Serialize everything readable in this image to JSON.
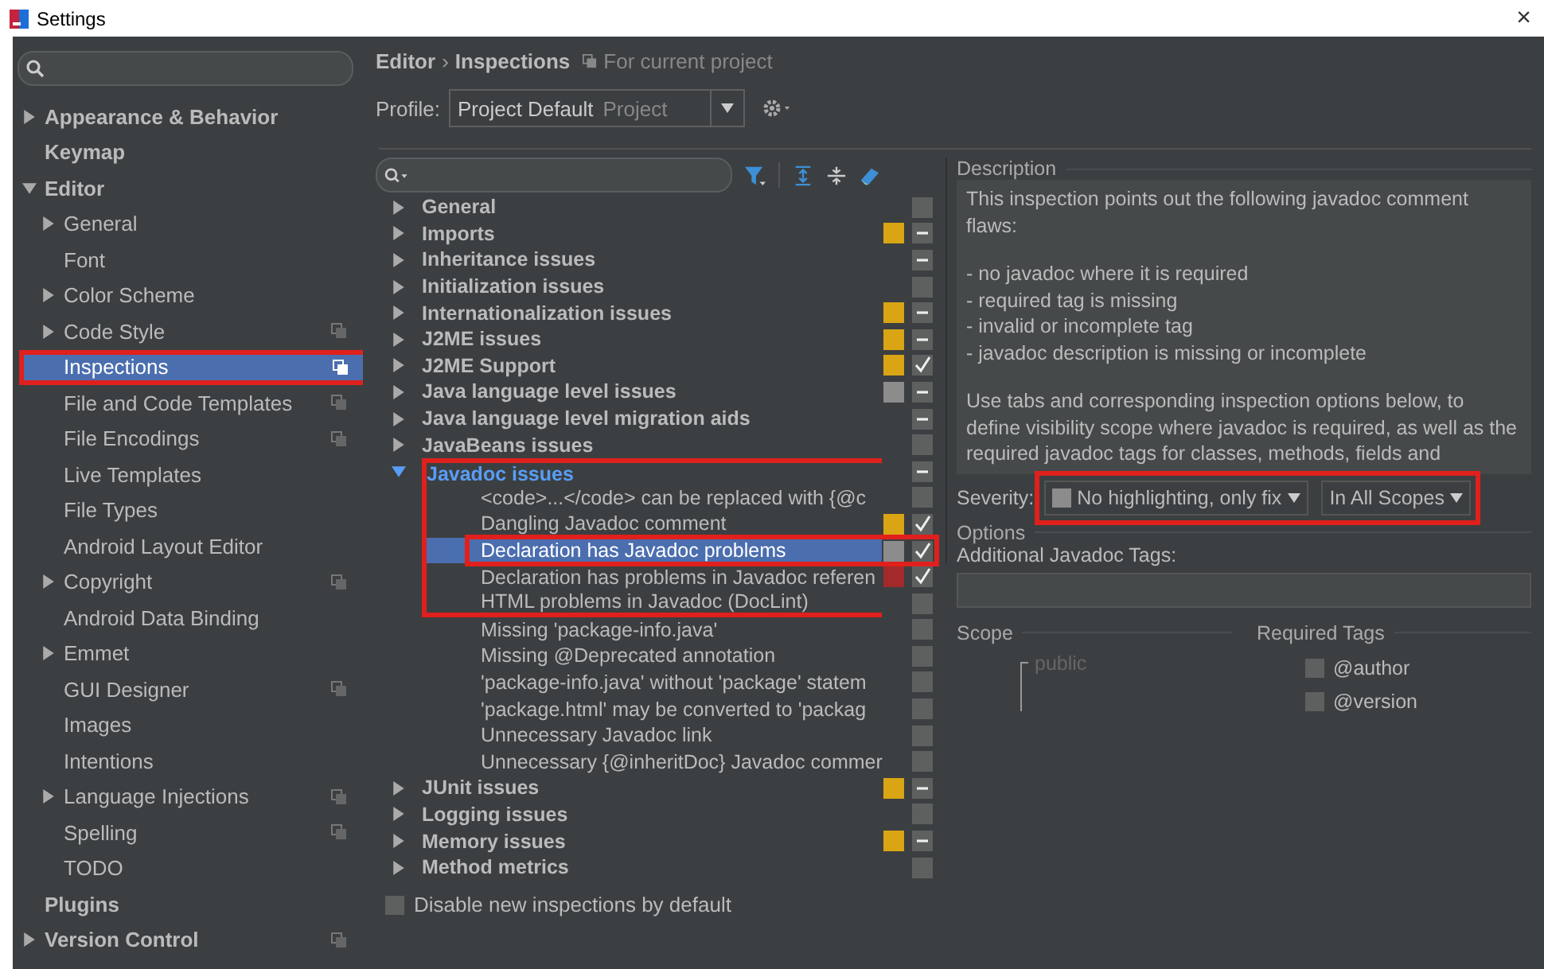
{
  "window": {
    "title": "Settings",
    "close": "×"
  },
  "sidebar": {
    "items": [
      {
        "label": "Appearance & Behavior",
        "expanded": false,
        "selected": false
      },
      {
        "label": "Keymap",
        "selected": false
      },
      {
        "label": "Editor",
        "expanded": true,
        "selected": false,
        "children": [
          {
            "label": "General",
            "expanded": false,
            "selected": false
          },
          {
            "label": "Font",
            "selected": false
          },
          {
            "label": "Color Scheme",
            "expanded": false,
            "selected": false
          },
          {
            "label": "Code Style",
            "expanded": false,
            "project": true,
            "selected": false
          },
          {
            "label": "Inspections",
            "project": true,
            "selected": true,
            "annotated": true
          },
          {
            "label": "File and Code Templates",
            "project": true,
            "selected": false
          },
          {
            "label": "File Encodings",
            "project": true,
            "selected": false
          },
          {
            "label": "Live Templates",
            "selected": false
          },
          {
            "label": "File Types",
            "selected": false
          },
          {
            "label": "Android Layout Editor",
            "selected": false
          },
          {
            "label": "Copyright",
            "expanded": false,
            "project": true,
            "selected": false
          },
          {
            "label": "Android Data Binding",
            "selected": false
          },
          {
            "label": "Emmet",
            "expanded": false,
            "selected": false
          },
          {
            "label": "GUI Designer",
            "project": true,
            "selected": false
          },
          {
            "label": "Images",
            "selected": false
          },
          {
            "label": "Intentions",
            "selected": false
          },
          {
            "label": "Language Injections",
            "expanded": false,
            "project": true,
            "selected": false
          },
          {
            "label": "Spelling",
            "project": true,
            "selected": false
          },
          {
            "label": "TODO",
            "selected": false
          }
        ]
      },
      {
        "label": "Plugins",
        "selected": false
      },
      {
        "label": "Version Control",
        "expanded": false,
        "project": true,
        "selected": false
      }
    ]
  },
  "breadcrumb": {
    "parent": "Editor",
    "separator": "›",
    "current": "Inspections",
    "scope": "For current project"
  },
  "profile": {
    "label": "Profile:",
    "value": "Project Default",
    "hint": "Project"
  },
  "inspections": [
    {
      "label": "General",
      "kind": "group",
      "checked": false,
      "mixed": false,
      "selected": false
    },
    {
      "label": "Imports",
      "kind": "group",
      "color": "#d9a514",
      "mixed": true,
      "selected": false
    },
    {
      "label": "Inheritance issues",
      "kind": "group",
      "mixed": true,
      "selected": false
    },
    {
      "label": "Initialization issues",
      "kind": "group",
      "checked": false,
      "mixed": false,
      "selected": false
    },
    {
      "label": "Internationalization issues",
      "kind": "group",
      "color": "#d9a514",
      "mixed": true,
      "selected": false
    },
    {
      "label": "J2ME issues",
      "kind": "group",
      "color": "#d9a514",
      "mixed": true,
      "selected": false
    },
    {
      "label": "J2ME Support",
      "kind": "group",
      "color": "#d9a514",
      "checked": true,
      "selected": false
    },
    {
      "label": "Java language level issues",
      "kind": "group",
      "color": "#8c8c8c",
      "mixed": true,
      "selected": false
    },
    {
      "label": "Java language level migration aids",
      "kind": "group",
      "mixed": true,
      "selected": false
    },
    {
      "label": "JavaBeans issues",
      "kind": "group",
      "checked": false,
      "mixed": false,
      "selected": false
    },
    {
      "label": "Javadoc issues",
      "kind": "group",
      "expanded": true,
      "modified": true,
      "mixed": true,
      "selected": false,
      "framed": true
    },
    {
      "label": "<code>...</code> can be replaced with {@c",
      "kind": "item",
      "checked": false,
      "mixed": false,
      "selected": false,
      "framed": true
    },
    {
      "label": "Dangling Javadoc comment",
      "kind": "item",
      "color": "#d9a514",
      "checked": true,
      "selected": false,
      "framed": true
    },
    {
      "label": "Declaration has Javadoc problems",
      "kind": "item",
      "color": "#8c8c8c",
      "checked": true,
      "selected": true,
      "framed": true,
      "annotated": true
    },
    {
      "label": "Declaration has problems in Javadoc referen",
      "kind": "item",
      "color": "#a3292b",
      "checked": true,
      "selected": false,
      "framed": true
    },
    {
      "label": "HTML problems in Javadoc (DocLint)",
      "kind": "item",
      "checked": false,
      "mixed": false,
      "selected": false,
      "framed": true
    },
    {
      "label": "Missing 'package-info.java'",
      "kind": "item",
      "checked": false,
      "mixed": false,
      "selected": false
    },
    {
      "label": "Missing @Deprecated annotation",
      "kind": "item",
      "checked": false,
      "mixed": false,
      "selected": false
    },
    {
      "label": "'package-info.java' without 'package' statem",
      "kind": "item",
      "checked": false,
      "mixed": false,
      "selected": false
    },
    {
      "label": "'package.html' may be converted to 'packag",
      "kind": "item",
      "checked": false,
      "mixed": false,
      "selected": false
    },
    {
      "label": "Unnecessary Javadoc link",
      "kind": "item",
      "checked": false,
      "mixed": false,
      "selected": false
    },
    {
      "label": "Unnecessary {@inheritDoc} Javadoc commer",
      "kind": "item",
      "checked": false,
      "mixed": false,
      "selected": false
    },
    {
      "label": "JUnit issues",
      "kind": "group",
      "color": "#d9a514",
      "mixed": true,
      "selected": false
    },
    {
      "label": "Logging issues",
      "kind": "group",
      "checked": false,
      "mixed": false,
      "selected": false
    },
    {
      "label": "Memory issues",
      "kind": "group",
      "color": "#d9a514",
      "mixed": true,
      "selected": false
    },
    {
      "label": "Method metrics",
      "kind": "group",
      "checked": false,
      "mixed": false,
      "selected": false
    }
  ],
  "disable_new": {
    "label": "Disable new inspections by default",
    "checked": false
  },
  "description": {
    "title": "Description",
    "paragraphs": [
      [
        "This inspection points out the following javadoc comment flaws:"
      ],
      [
        "- no javadoc where it is required",
        "- required tag is missing",
        "- invalid or incomplete tag",
        "- javadoc description is missing or incomplete"
      ],
      [
        "Use tabs and corresponding inspection options below, to define visibility scope where javadoc is required, as well as the required javadoc tags for classes, methods, fields and"
      ]
    ]
  },
  "severity": {
    "label": "Severity:",
    "value": "No highlighting, only fix",
    "color": "#8c8c8c",
    "scope": "In All Scopes",
    "annotated": true
  },
  "options": {
    "title": "Options",
    "tags_label": "Additional Javadoc Tags:",
    "scope_title": "Scope",
    "scope_level": "public",
    "tags_title": "Required Tags",
    "tags": [
      {
        "label": "@author",
        "checked": false
      },
      {
        "label": "@version",
        "checked": false
      }
    ]
  }
}
